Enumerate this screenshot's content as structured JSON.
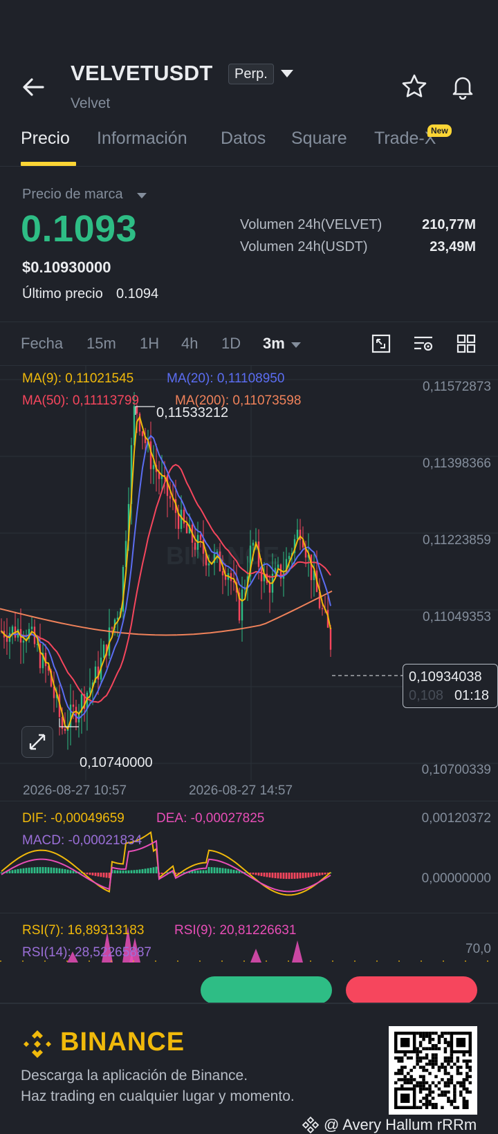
{
  "header": {
    "symbol": "VELVETUSDT",
    "contract_type": "Perp.",
    "subtitle": "Velvet"
  },
  "tabs": [
    {
      "label": "Precio",
      "active": true
    },
    {
      "label": "Información",
      "active": false
    },
    {
      "label": "Datos",
      "active": false
    },
    {
      "label": "Square",
      "active": false
    },
    {
      "label": "Trade-X",
      "active": false,
      "badge": "New"
    }
  ],
  "market": {
    "mark_label": "Precio de marca",
    "mark_price": "0.1093",
    "usd_price": "$0.10930000",
    "last_label": "Último precio",
    "last_price": "0.1094",
    "vol1_label": "Volumen 24h(VELVET)",
    "vol1_value": "210,77M",
    "vol2_label": "Volumen 24h(USDT)",
    "vol2_value": "23,49M"
  },
  "timeframes": {
    "fecha": "Fecha",
    "items": [
      "15m",
      "1H",
      "4h",
      "1D"
    ],
    "selected": "3m"
  },
  "chart": {
    "ma9": "MA(9): 0,11021545",
    "ma20": "MA(20): 0,11108950",
    "ma50": "MA(50): 0,11113799",
    "ma200": "MA(200): 0,11073598",
    "high_marker": "0,11533212",
    "low_marker": "0,10740000",
    "price_axis": [
      "0,11572873",
      "0,11398366",
      "0,11223859",
      "0,11049353",
      "0,10700339"
    ],
    "current_price": "0,10934038",
    "countdown": "01:18",
    "hidden_tick": "0,108",
    "time_axis": [
      "2026-08-27 10:57",
      "2026-08-27 14:57"
    ],
    "watermark": "BINANCE",
    "colors": {
      "ma9": "#f0b90b",
      "ma20": "#5b6df2",
      "ma50": "#f6465d",
      "ma200": "#f0825a",
      "up": "#2ebd85",
      "down": "#f6465d"
    }
  },
  "macd": {
    "dif": "DIF: -0,00049659",
    "dea": "DEA: -0,00027825",
    "macd": "MACD: -0,00021834",
    "axis": [
      "0,00120372",
      "0,00000000"
    ]
  },
  "rsi": {
    "rsi7": "RSI(7): 16,89313183",
    "rsi9": "RSI(9): 20,81226631",
    "rsi14": "RSI(14): 28,52265887",
    "axis": "70,0"
  },
  "footer": {
    "brand": "BINANCE",
    "line1": "Descarga la aplicación de Binance.",
    "line2": "Haz trading en cualquier lugar y momento.",
    "credit": "@ Avery Hallum rRRm"
  }
}
